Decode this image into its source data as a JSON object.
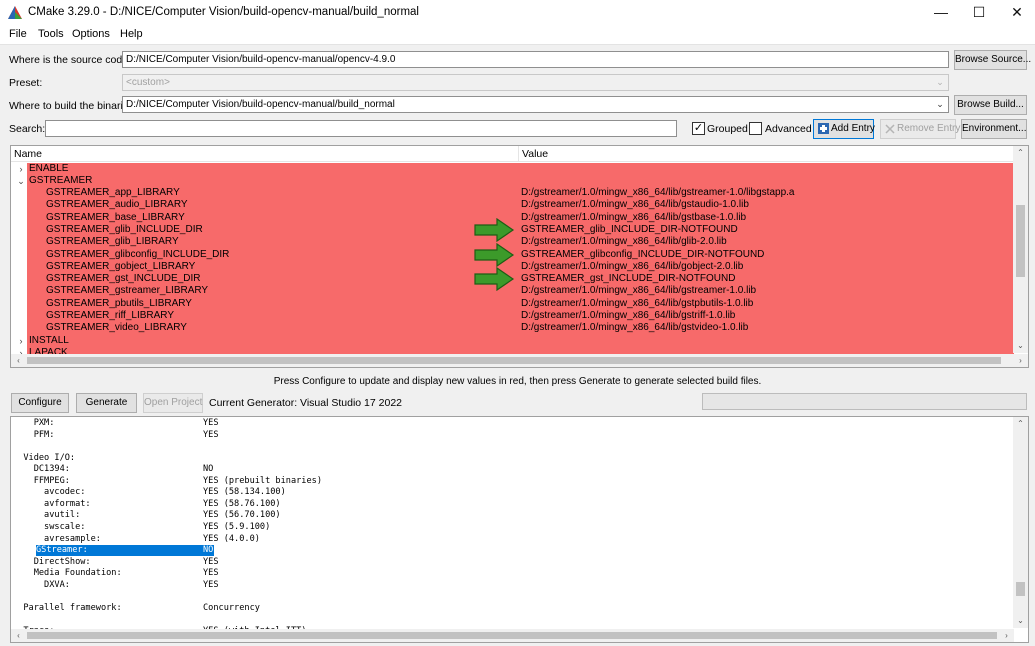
{
  "window": {
    "title": "CMake 3.29.0 - D:/NICE/Computer Vision/build-opencv-manual/build_normal",
    "minimize_glyph": "—",
    "maximize_glyph": "☐",
    "close_glyph": "✕"
  },
  "menu": [
    "File",
    "Tools",
    "Options",
    "Help"
  ],
  "source": {
    "label": "Where is the source code:",
    "value": "D:/NICE/Computer Vision/build-opencv-manual/opencv-4.9.0",
    "browse_label": "Browse Source..."
  },
  "preset": {
    "label": "Preset:",
    "value": "<custom>"
  },
  "build": {
    "label": "Where to build the binaries:",
    "value": "D:/NICE/Computer Vision/build-opencv-manual/build_normal",
    "browse_label": "Browse Build..."
  },
  "search": {
    "label": "Search:",
    "value": "",
    "grouped_label": "Grouped",
    "grouped_checked": true,
    "advanced_label": "Advanced",
    "advanced_checked": false,
    "add_entry_label": "Add Entry",
    "remove_entry_label": "Remove Entry",
    "environment_label": "Environment..."
  },
  "table": {
    "name_header": "Name",
    "value_header": "Value",
    "highlight_color": "#f76a6a",
    "groups": [
      {
        "name": "ENABLE",
        "expanded": false
      },
      {
        "name": "GSTREAMER",
        "expanded": true
      },
      {
        "name": "INSTALL",
        "expanded": false
      },
      {
        "name": "LAPACK",
        "expanded": false
      }
    ],
    "entries": [
      {
        "name": "GSTREAMER_app_LIBRARY",
        "value": "D:/gstreamer/1.0/mingw_x86_64/lib/gstreamer-1.0/libgstapp.a",
        "arrow": false
      },
      {
        "name": "GSTREAMER_audio_LIBRARY",
        "value": "D:/gstreamer/1.0/mingw_x86_64/lib/gstaudio-1.0.lib",
        "arrow": false
      },
      {
        "name": "GSTREAMER_base_LIBRARY",
        "value": "D:/gstreamer/1.0/mingw_x86_64/lib/gstbase-1.0.lib",
        "arrow": false
      },
      {
        "name": "GSTREAMER_glib_INCLUDE_DIR",
        "value": "GSTREAMER_glib_INCLUDE_DIR-NOTFOUND",
        "arrow": true
      },
      {
        "name": "GSTREAMER_glib_LIBRARY",
        "value": "D:/gstreamer/1.0/mingw_x86_64/lib/glib-2.0.lib",
        "arrow": false
      },
      {
        "name": "GSTREAMER_glibconfig_INCLUDE_DIR",
        "value": "GSTREAMER_glibconfig_INCLUDE_DIR-NOTFOUND",
        "arrow": true
      },
      {
        "name": "GSTREAMER_gobject_LIBRARY",
        "value": "D:/gstreamer/1.0/mingw_x86_64/lib/gobject-2.0.lib",
        "arrow": false
      },
      {
        "name": "GSTREAMER_gst_INCLUDE_DIR",
        "value": "GSTREAMER_gst_INCLUDE_DIR-NOTFOUND",
        "arrow": true
      },
      {
        "name": "GSTREAMER_gstreamer_LIBRARY",
        "value": "D:/gstreamer/1.0/mingw_x86_64/lib/gstreamer-1.0.lib",
        "arrow": false
      },
      {
        "name": "GSTREAMER_pbutils_LIBRARY",
        "value": "D:/gstreamer/1.0/mingw_x86_64/lib/gstpbutils-1.0.lib",
        "arrow": false
      },
      {
        "name": "GSTREAMER_riff_LIBRARY",
        "value": "D:/gstreamer/1.0/mingw_x86_64/lib/gstriff-1.0.lib",
        "arrow": false
      },
      {
        "name": "GSTREAMER_video_LIBRARY",
        "value": "D:/gstreamer/1.0/mingw_x86_64/lib/gstvideo-1.0.lib",
        "arrow": false
      }
    ],
    "arrow_color": "#3c9a2a"
  },
  "hint": "Press Configure to update and display new values in red, then press Generate to generate selected build files.",
  "actions": {
    "configure_label": "Configure",
    "generate_label": "Generate",
    "open_project_label": "Open Project",
    "generator_text": "Current Generator: Visual Studio 17 2022"
  },
  "output": [
    {
      "key": "    PXM:",
      "value": "YES",
      "selected": false
    },
    {
      "key": "    PFM:",
      "value": "YES",
      "selected": false
    },
    {
      "key": "",
      "value": "",
      "selected": false
    },
    {
      "key": "  Video I/O:",
      "value": "",
      "selected": false
    },
    {
      "key": "    DC1394:",
      "value": "NO",
      "selected": false
    },
    {
      "key": "    FFMPEG:",
      "value": "YES (prebuilt binaries)",
      "selected": false
    },
    {
      "key": "      avcodec:",
      "value": "YES (58.134.100)",
      "selected": false
    },
    {
      "key": "      avformat:",
      "value": "YES (58.76.100)",
      "selected": false
    },
    {
      "key": "      avutil:",
      "value": "YES (56.70.100)",
      "selected": false
    },
    {
      "key": "      swscale:",
      "value": "YES (5.9.100)",
      "selected": false
    },
    {
      "key": "      avresample:",
      "value": "YES (4.0.0)",
      "selected": false
    },
    {
      "key": "    GStreamer:",
      "value": "NO",
      "selected": true
    },
    {
      "key": "    DirectShow:",
      "value": "YES",
      "selected": false
    },
    {
      "key": "    Media Foundation:",
      "value": "YES",
      "selected": false
    },
    {
      "key": "      DXVA:",
      "value": "YES",
      "selected": false
    },
    {
      "key": "",
      "value": "",
      "selected": false
    },
    {
      "key": "  Parallel framework:",
      "value": "Concurrency",
      "selected": false
    },
    {
      "key": "",
      "value": "",
      "selected": false
    },
    {
      "key": "  Trace:",
      "value": "YES (with Intel ITT)",
      "selected": false
    }
  ]
}
